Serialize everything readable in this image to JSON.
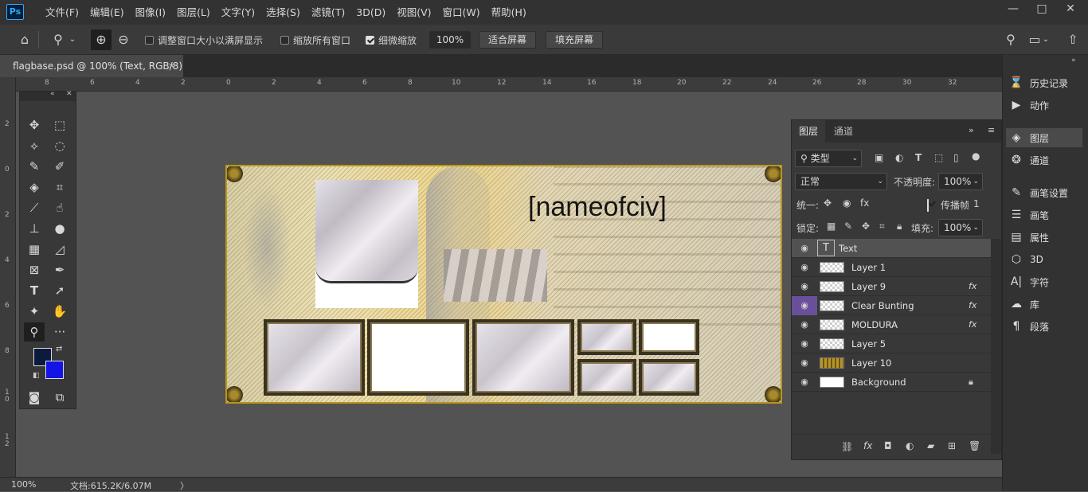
{
  "app": {
    "logo": "Ps"
  },
  "menu": [
    "文件(F)",
    "编辑(E)",
    "图像(I)",
    "图层(L)",
    "文字(Y)",
    "选择(S)",
    "滤镜(T)",
    "3D(D)",
    "视图(V)",
    "窗口(W)",
    "帮助(H)"
  ],
  "window_controls": {
    "minimize": "—",
    "maximize": "□",
    "close": "✕"
  },
  "options_bar": {
    "resize_windows_label": "调整窗口大小以满屏显示",
    "resize_windows_checked": false,
    "zoom_all_label": "缩放所有窗口",
    "zoom_all_checked": false,
    "scrubby_label": "细微缩放",
    "scrubby_checked": true,
    "zoom_value": "100%",
    "fit_screen_label": "适合屏幕",
    "fill_screen_label": "填充屏幕"
  },
  "document_tab": {
    "title": "flagbase.psd @ 100% (Text, RGB/8)",
    "close": "×"
  },
  "ruler_h_labels": [
    "8",
    "6",
    "4",
    "2",
    "0",
    "2",
    "4",
    "6",
    "8",
    "10",
    "12",
    "14",
    "16",
    "18",
    "20",
    "22",
    "24",
    "26",
    "28",
    "30",
    "32"
  ],
  "ruler_v_labels": [
    "2",
    "0",
    "2",
    "4",
    "6",
    "8",
    "1\n0",
    "1\n2"
  ],
  "canvas": {
    "text_layer_content": "[nameofciv]"
  },
  "status": {
    "zoom": "100%",
    "doc_info": "文档:615.2K/6.07M",
    "arrow": "〉"
  },
  "dock": {
    "items": [
      {
        "icon": "history-icon",
        "label": "历史记录"
      },
      {
        "icon": "actions-icon",
        "label": "动作"
      },
      {
        "icon": "layers-icon",
        "label": "图层"
      },
      {
        "icon": "channels-icon",
        "label": "通道"
      },
      {
        "icon": "brush-settings-icon",
        "label": "画笔设置"
      },
      {
        "icon": "brush-icon",
        "label": "画笔"
      },
      {
        "icon": "properties-icon",
        "label": "属性"
      },
      {
        "icon": "3d-icon",
        "label": "3D"
      },
      {
        "icon": "character-icon",
        "label": "字符"
      },
      {
        "icon": "libraries-icon",
        "label": "库"
      },
      {
        "icon": "paragraph-icon",
        "label": "段落"
      }
    ]
  },
  "layers_panel": {
    "tabs": [
      "图层",
      "通道"
    ],
    "filter_label": "类型",
    "blend_mode": "正常",
    "opacity_label": "不透明度:",
    "opacity_value": "100%",
    "unify_label": "统一:",
    "propagate_label": "传播帧",
    "propagate_value": "1",
    "lock_label": "锁定:",
    "fill_label": "填充:",
    "fill_value": "100%",
    "layers": [
      {
        "name": "Text",
        "type": "text",
        "fx": ""
      },
      {
        "name": "Layer 1",
        "type": "pixel",
        "fx": ""
      },
      {
        "name": "Layer 9",
        "type": "pixel",
        "fx": "fx"
      },
      {
        "name": "Clear Bunting",
        "type": "pixel",
        "fx": "fx"
      },
      {
        "name": "MOLDURA",
        "type": "pixel",
        "fx": "fx"
      },
      {
        "name": "Layer 5",
        "type": "pixel",
        "fx": ""
      },
      {
        "name": "Layer 10",
        "type": "pixel",
        "fx": ""
      },
      {
        "name": "Background",
        "type": "background",
        "fx": ""
      }
    ],
    "active_layer": "Text"
  },
  "colors": {
    "foreground": "#0b1a3d",
    "background": "#1414e6",
    "accent": "#31a8ff"
  }
}
